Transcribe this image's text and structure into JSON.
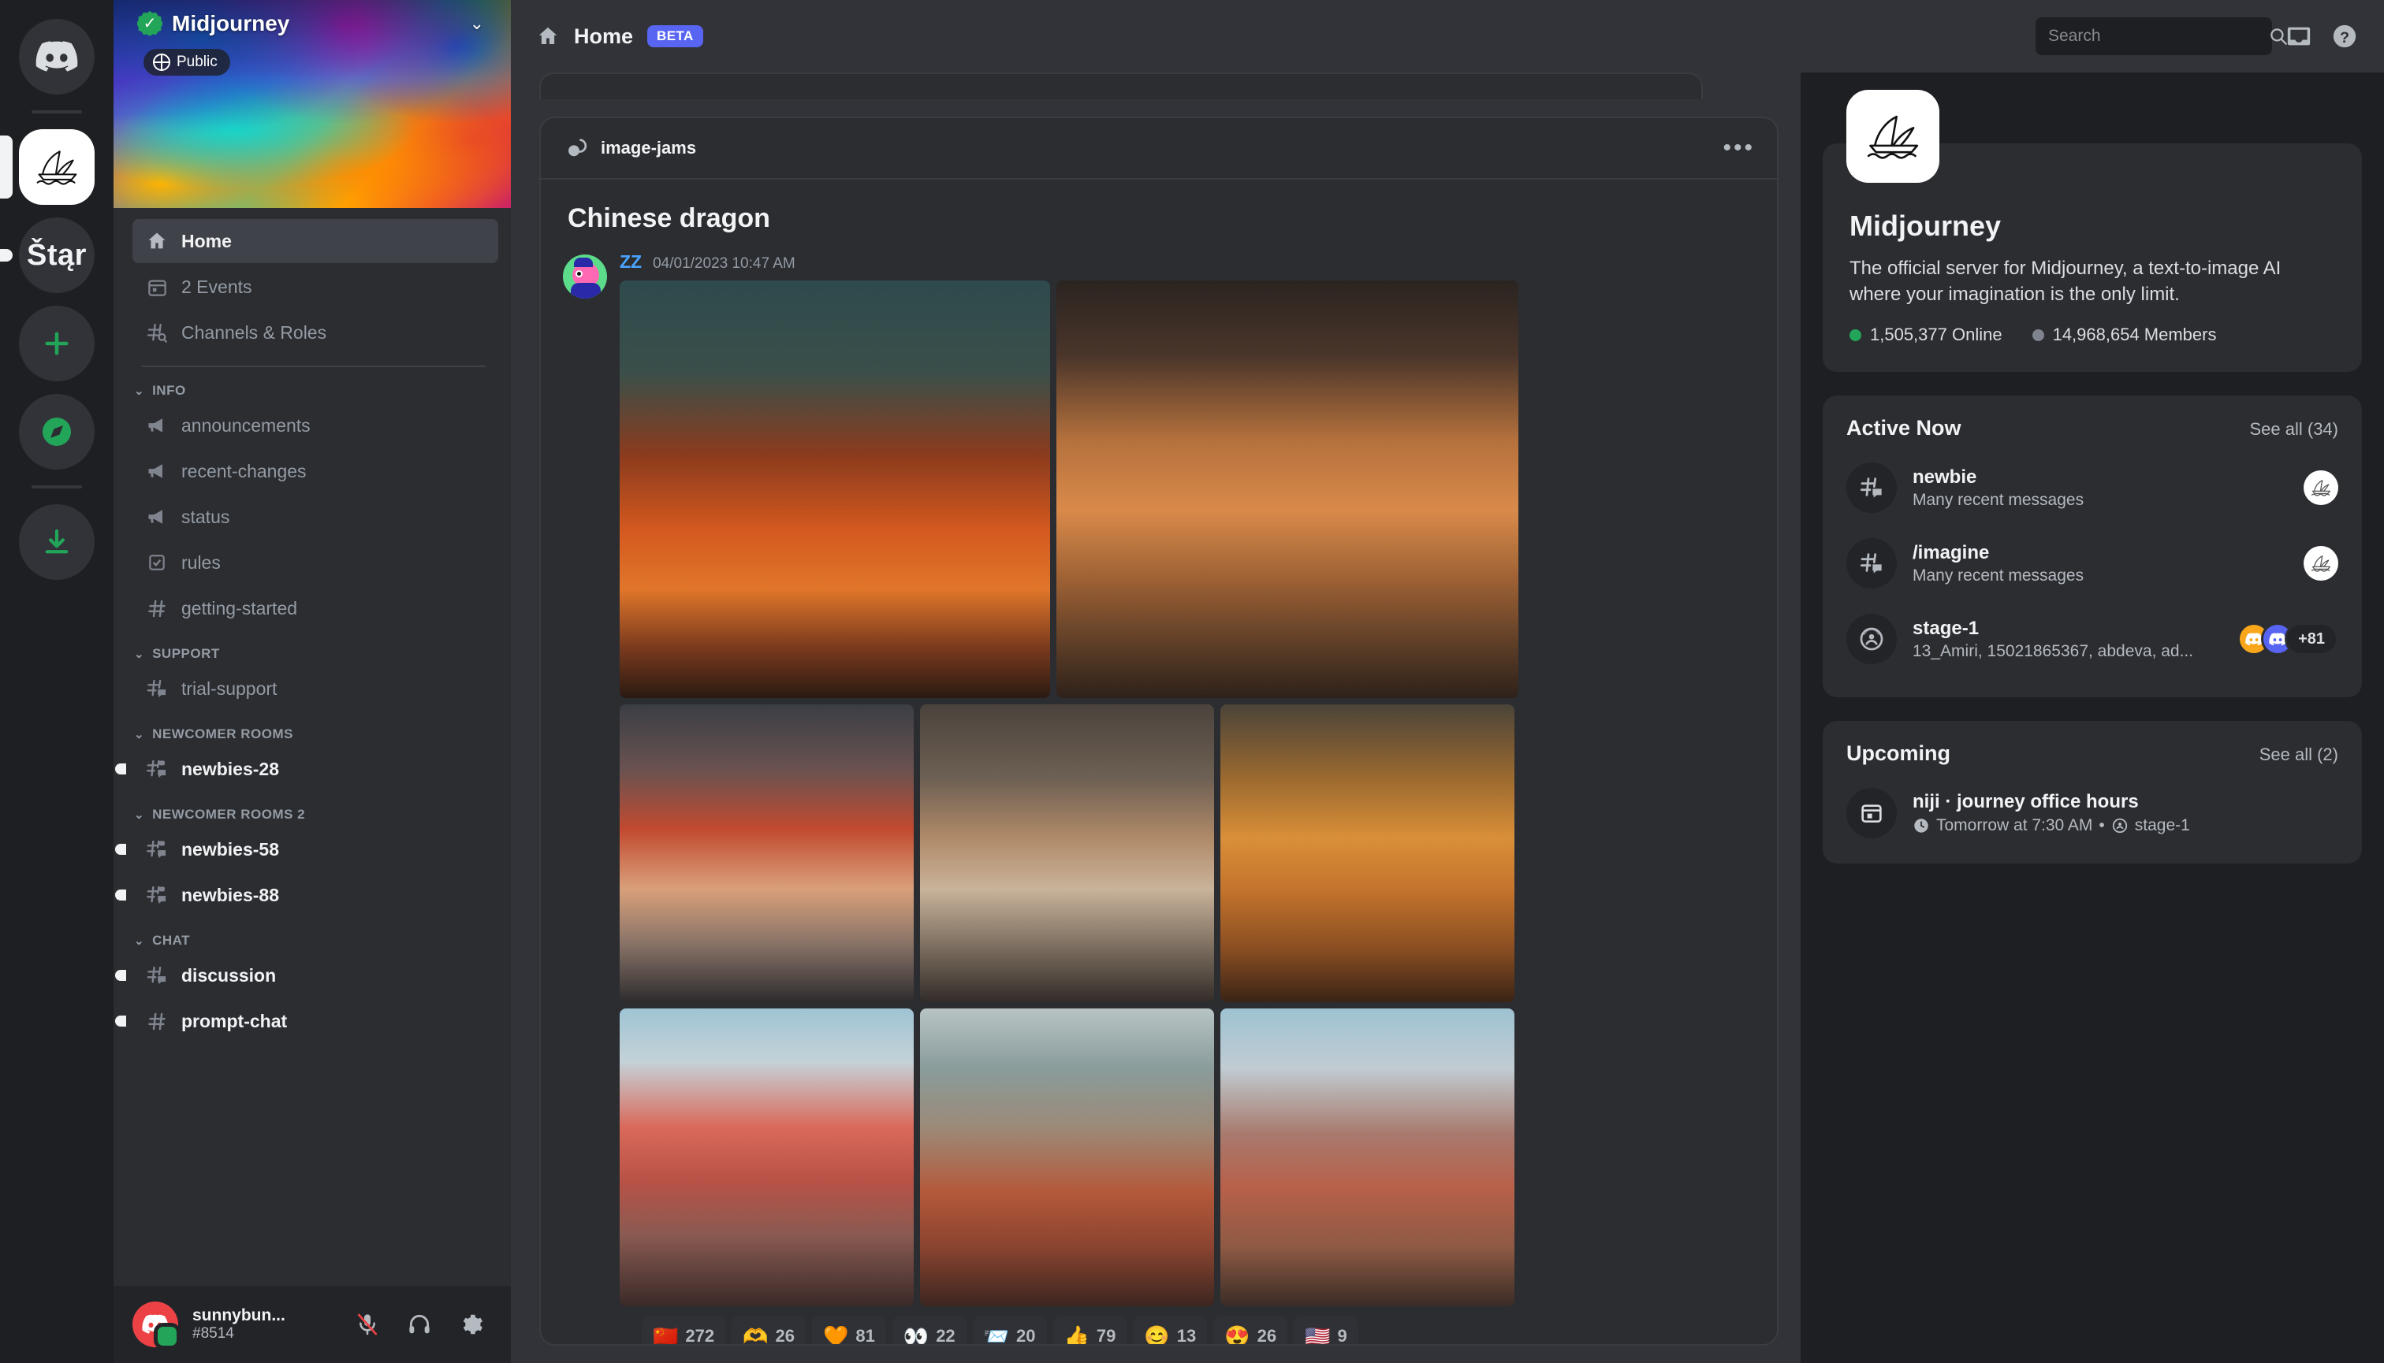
{
  "rail": {
    "items": [
      {
        "name": "discord-home",
        "type": "discord-logo",
        "selected": false
      },
      {
        "name": "midjourney-server",
        "type": "midjourney-logo",
        "selected": true
      },
      {
        "name": "sttar-server",
        "type": "text",
        "label": "Štąr",
        "selected": false
      },
      {
        "name": "add-server",
        "type": "plus",
        "label": "+",
        "selected": false
      },
      {
        "name": "explore-servers",
        "type": "compass",
        "selected": false
      },
      {
        "name": "download-apps",
        "type": "download",
        "selected": false
      }
    ]
  },
  "sidebar": {
    "server_name": "Midjourney",
    "privacy_label": "Public",
    "nav": [
      {
        "label": "Home",
        "icon": "home-icon",
        "active": true
      },
      {
        "label": "2 Events",
        "icon": "calendar-icon",
        "active": false
      },
      {
        "label": "Channels & Roles",
        "icon": "channels-roles-icon",
        "active": false
      }
    ],
    "categories": [
      {
        "label": "INFO",
        "channels": [
          {
            "label": "announcements",
            "icon": "announcement-icon",
            "unread": false
          },
          {
            "label": "recent-changes",
            "icon": "announcement-icon",
            "unread": false
          },
          {
            "label": "status",
            "icon": "announcement-icon",
            "unread": false
          },
          {
            "label": "rules",
            "icon": "rules-icon",
            "unread": false
          },
          {
            "label": "getting-started",
            "icon": "hash-icon",
            "unread": false
          }
        ]
      },
      {
        "label": "SUPPORT",
        "channels": [
          {
            "label": "trial-support",
            "icon": "forum-icon",
            "unread": false
          }
        ]
      },
      {
        "label": "NEWCOMER ROOMS",
        "channels": [
          {
            "label": "newbies-28",
            "icon": "forum-locked-icon",
            "unread": true
          }
        ]
      },
      {
        "label": "NEWCOMER ROOMS 2",
        "channels": [
          {
            "label": "newbies-58",
            "icon": "forum-locked-icon",
            "unread": true
          },
          {
            "label": "newbies-88",
            "icon": "forum-locked-icon",
            "unread": true
          }
        ]
      },
      {
        "label": "CHAT",
        "channels": [
          {
            "label": "discussion",
            "icon": "forum-icon",
            "unread": true
          },
          {
            "label": "prompt-chat",
            "icon": "hash-icon",
            "unread": true
          }
        ]
      }
    ],
    "user": {
      "name": "sunnybun...",
      "tag": "#8514",
      "status": "online"
    },
    "user_buttons": [
      {
        "name": "mute-button",
        "icon": "mic-muted-icon"
      },
      {
        "name": "deafen-button",
        "icon": "headphones-icon"
      },
      {
        "name": "user-settings-button",
        "icon": "gear-icon"
      }
    ]
  },
  "topbar": {
    "title": "Home",
    "badge": "BETA",
    "search_placeholder": "Search",
    "search_value": "",
    "icons": [
      {
        "name": "inbox-button",
        "icon": "inbox-icon"
      },
      {
        "name": "help-button",
        "icon": "help-icon"
      }
    ]
  },
  "post": {
    "forum_channel": "image-jams",
    "title": "Chinese dragon",
    "author": "ZZ",
    "timestamp": "04/01/2023 10:47 AM",
    "images": [
      {
        "alt": "red chinese dragon roaring over fire and army",
        "art": "linear-gradient(180deg,#2e4a4c 0%,#3a4f4a 22%,#8c3b1d 42%,#d4591f 60%,#e0762a 74%,#7a3a1d 88%,#2a1a12 100%)"
      },
      {
        "alt": "black dragon over burning village with army",
        "art": "linear-gradient(180deg,#2a2420 0%,#4a352a 18%,#b4703c 38%,#d98a4a 55%,#9c6034 72%,#5a3c26 88%,#2e211a 100%)"
      },
      {
        "alt": "white dragon breathing fire over crowd",
        "art": "linear-gradient(180deg,#3a3e45 0%,#6a5250 22%,#c24a30 42%,#d9a07a 62%,#8a7468 80%,#2e2c2e 100%)"
      },
      {
        "alt": "grey dragon above marching army",
        "art": "linear-gradient(180deg,#4a433c 0%,#6e6054 25%,#b08a68 45%,#c9b39a 62%,#7a6c5e 82%,#322c28 100%)"
      },
      {
        "alt": "golden dragon with woman on stairs",
        "art": "linear-gradient(180deg,#4a4438 0%,#9c6a30 25%,#d98f38 45%,#c4742c 62%,#8a4e22 82%,#3a2416 100%)"
      },
      {
        "alt": "red dragon over pagoda with cherry blossoms",
        "art": "linear-gradient(180deg,#9fc4d4 0%,#c4d2d8 18%,#d9695a 40%,#b85246 58%,#8a5a52 76%,#3a2a28 100%)"
      },
      {
        "alt": "teal dragon over temple with red trees",
        "art": "linear-gradient(180deg,#b8c4c4 0%,#8a9c9c 20%,#9c8a78 40%,#b4583a 62%,#8a4430 80%,#3c2620 100%)"
      },
      {
        "alt": "dragon over mountains with red foliage and riders",
        "art": "linear-gradient(180deg,#9ec2d2 0%,#c0ccd2 20%,#a87a6e 42%,#b8604a 60%,#8e5a44 80%,#3a2c26 100%)"
      }
    ],
    "reactions": [
      {
        "emoji": "🇨🇳",
        "count": "272",
        "name": "china-flag"
      },
      {
        "emoji": "🫶",
        "count": "26",
        "name": "heart-hands"
      },
      {
        "emoji": "🧡",
        "count": "81",
        "name": "orange-heart"
      },
      {
        "emoji": "👀",
        "count": "22",
        "name": "eyes"
      },
      {
        "emoji": "📨",
        "count": "20",
        "name": "incoming-envelope"
      },
      {
        "emoji": "👍",
        "count": "79",
        "name": "thumbs-up"
      },
      {
        "emoji": "😊",
        "count": "13",
        "name": "smiling-face"
      },
      {
        "emoji": "😍",
        "count": "26",
        "name": "heart-eyes"
      },
      {
        "emoji": "🇺🇸",
        "count": "9",
        "name": "usa-flag"
      }
    ]
  },
  "right": {
    "server": {
      "name": "Midjourney",
      "description": "The official server for Midjourney, a text-to-image AI where your imagination is the only limit.",
      "online": "1,505,377 Online",
      "members": "14,968,654 Members",
      "online_color": "#23a559",
      "members_color": "#80848e"
    },
    "active_now": {
      "title": "Active Now",
      "see_all": "See all (34)",
      "rows": [
        {
          "name": "newbie",
          "sub": "Many recent messages",
          "icon": "forum-icon",
          "right_type": "logo"
        },
        {
          "name": "/imagine",
          "sub": "Many recent messages",
          "icon": "forum-icon",
          "right_type": "logo"
        },
        {
          "name": "stage-1",
          "sub": "13_Amiri, 15021865367, abdeva, ad...",
          "icon": "stage-icon",
          "right_type": "avatars",
          "extra": "+81"
        }
      ]
    },
    "upcoming": {
      "title": "Upcoming",
      "see_all": "See all (2)",
      "rows": [
        {
          "name": "niji · journey office hours",
          "time": "Tomorrow at 7:30 AM",
          "location": "stage-1",
          "icon": "calendar-icon"
        }
      ]
    }
  }
}
